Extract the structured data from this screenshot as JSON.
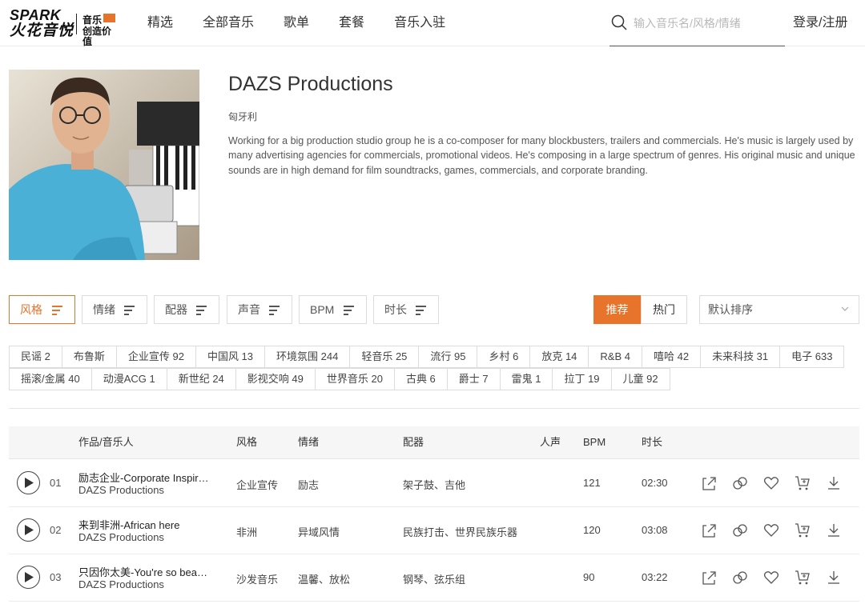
{
  "header": {
    "logo": {
      "line1": "SPARK",
      "line2": "火花音悦",
      "slogan1": "音乐",
      "slogan2": "创造价值"
    },
    "nav": [
      "精选",
      "全部音乐",
      "歌单",
      "套餐",
      "音乐入驻"
    ],
    "search_placeholder": "输入音乐名/风格/情绪",
    "login": "登录/注册"
  },
  "artist": {
    "name": "DAZS Productions",
    "region": "匈牙利",
    "description": "Working for a big production studio group he is a co-composer for many blockbusters, trailers and commercials. He's music is largely used by many advertising agencies for commercials, promotional videos. He's composing in a large spectrum of genres. His original music and unique sounds are in high demand for film soundtracks, games, commercials, and corporate branding."
  },
  "filters": {
    "buttons": [
      "风格",
      "情绪",
      "配器",
      "声音",
      "BPM",
      "时长"
    ],
    "active_index": 0,
    "tab_recommend": "推荐",
    "tab_hot": "热门",
    "sort_label": "默认排序"
  },
  "tags": {
    "row1": [
      "民谣 2",
      "布鲁斯",
      "企业宣传 92",
      "中国风 13",
      "环境氛围 244",
      "轻音乐 25",
      "流行 95",
      "乡村 6",
      "放克 14",
      "R&B 4",
      "嘻哈 42",
      "未来科技 31",
      "电子 633"
    ],
    "row2": [
      "摇滚/金属 40",
      "动漫ACG 1",
      "新世纪 24",
      "影视交响 49",
      "世界音乐 20",
      "古典 6",
      "爵士 7",
      "雷鬼 1",
      "拉丁 19",
      "儿童 92"
    ]
  },
  "table": {
    "headers": {
      "work": "作品/音乐人",
      "style": "风格",
      "mood": "情绪",
      "instrument": "配器",
      "vocal": "人声",
      "bpm": "BPM",
      "duration": "时长"
    },
    "rows": [
      {
        "num": "01",
        "title": "励志企业-Corporate Inspiring",
        "artist": "DAZS Productions",
        "style": "企业宣传",
        "mood": "励志",
        "instrument": "架子鼓、吉他",
        "vocal": "",
        "bpm": "121",
        "duration": "02:30"
      },
      {
        "num": "02",
        "title": "来到非洲-African here",
        "artist": "DAZS Productions",
        "style": "非洲",
        "mood": "异域风情",
        "instrument": "民族打击、世界民族乐器",
        "vocal": "",
        "bpm": "120",
        "duration": "03:08"
      },
      {
        "num": "03",
        "title": "只因你太美-You're so beautiful",
        "artist": "DAZS Productions",
        "style": "沙发音乐",
        "mood": "温馨、放松",
        "instrument": "钢琴、弦乐组",
        "vocal": "",
        "bpm": "90",
        "duration": "03:22"
      }
    ],
    "row_actions": [
      "share-icon",
      "link-icon",
      "heart-icon",
      "cart-icon",
      "download-icon"
    ]
  },
  "colors": {
    "accent": "#e8732a",
    "text": "#333333",
    "border": "#dcdcdc",
    "table_header_bg": "#f6f6f6"
  }
}
